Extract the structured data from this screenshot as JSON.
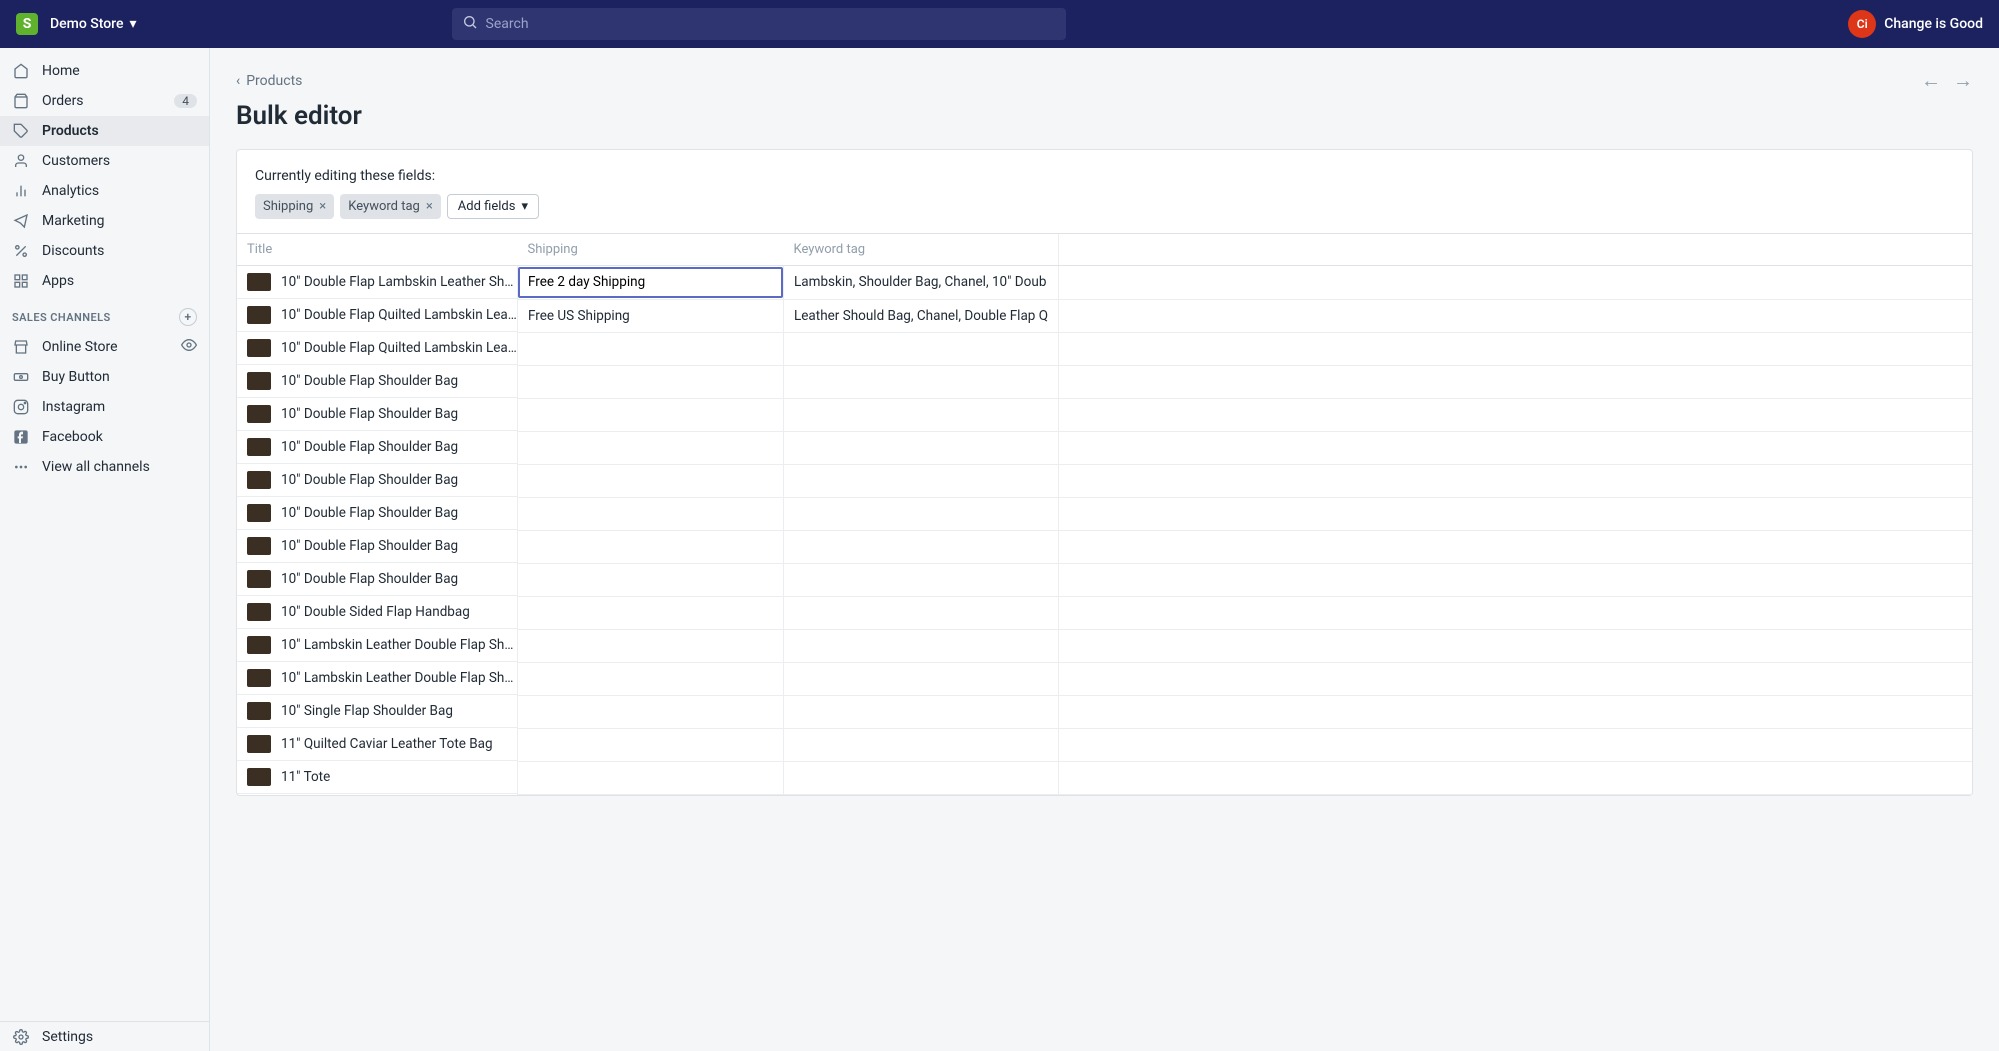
{
  "header": {
    "store_name": "Demo Store",
    "search_placeholder": "Search",
    "user_initials": "Ci",
    "user_name": "Change is Good"
  },
  "sidebar": {
    "items": [
      {
        "label": "Home",
        "icon": "home"
      },
      {
        "label": "Orders",
        "icon": "orders",
        "badge": "4"
      },
      {
        "label": "Products",
        "icon": "products",
        "active": true
      },
      {
        "label": "Customers",
        "icon": "customers"
      },
      {
        "label": "Analytics",
        "icon": "analytics"
      },
      {
        "label": "Marketing",
        "icon": "marketing"
      },
      {
        "label": "Discounts",
        "icon": "discounts"
      },
      {
        "label": "Apps",
        "icon": "apps"
      }
    ],
    "channels_heading": "SALES CHANNELS",
    "channels": [
      {
        "label": "Online Store",
        "icon": "store",
        "tail": "eye"
      },
      {
        "label": "Buy Button",
        "icon": "buybutton"
      },
      {
        "label": "Instagram",
        "icon": "instagram"
      },
      {
        "label": "Facebook",
        "icon": "facebook"
      },
      {
        "label": "View all channels",
        "icon": "more"
      }
    ],
    "settings_label": "Settings"
  },
  "page": {
    "breadcrumb": "Products",
    "title": "Bulk editor",
    "editing_label": "Currently editing these fields:",
    "field_tags": [
      "Shipping",
      "Keyword tag"
    ],
    "add_fields_label": "Add fields"
  },
  "table": {
    "columns": [
      "Title",
      "Shipping",
      "Keyword tag"
    ],
    "editing_cell": {
      "row": 0,
      "col": 1
    },
    "rows": [
      {
        "title": "10\" Double Flap Lambskin Leather Sh…",
        "shipping": "Free 2 day Shipping",
        "keyword": "Lambskin, Shoulder Bag, Chanel, 10\" Doub"
      },
      {
        "title": "10\" Double Flap Quilted Lambskin Lea…",
        "shipping": "Free US Shipping",
        "keyword": "Leather Should Bag, Chanel, Double Flap Q"
      },
      {
        "title": "10\" Double Flap Quilted Lambskin Lea…",
        "shipping": "",
        "keyword": ""
      },
      {
        "title": "10\" Double Flap Shoulder Bag",
        "shipping": "",
        "keyword": ""
      },
      {
        "title": "10\" Double Flap Shoulder Bag",
        "shipping": "",
        "keyword": ""
      },
      {
        "title": "10\" Double Flap Shoulder Bag",
        "shipping": "",
        "keyword": ""
      },
      {
        "title": "10\" Double Flap Shoulder Bag",
        "shipping": "",
        "keyword": ""
      },
      {
        "title": "10\" Double Flap Shoulder Bag",
        "shipping": "",
        "keyword": ""
      },
      {
        "title": "10\" Double Flap Shoulder Bag",
        "shipping": "",
        "keyword": ""
      },
      {
        "title": "10\" Double Flap Shoulder Bag",
        "shipping": "",
        "keyword": ""
      },
      {
        "title": "10\" Double Sided Flap Handbag",
        "shipping": "",
        "keyword": ""
      },
      {
        "title": "10\" Lambskin Leather Double Flap Sh…",
        "shipping": "",
        "keyword": ""
      },
      {
        "title": "10\" Lambskin Leather Double Flap Sh…",
        "shipping": "",
        "keyword": ""
      },
      {
        "title": "10\" Single Flap Shoulder Bag",
        "shipping": "",
        "keyword": ""
      },
      {
        "title": "11\" Quilted Caviar Leather Tote Bag",
        "shipping": "",
        "keyword": ""
      },
      {
        "title": "11\" Tote",
        "shipping": "",
        "keyword": ""
      }
    ]
  }
}
